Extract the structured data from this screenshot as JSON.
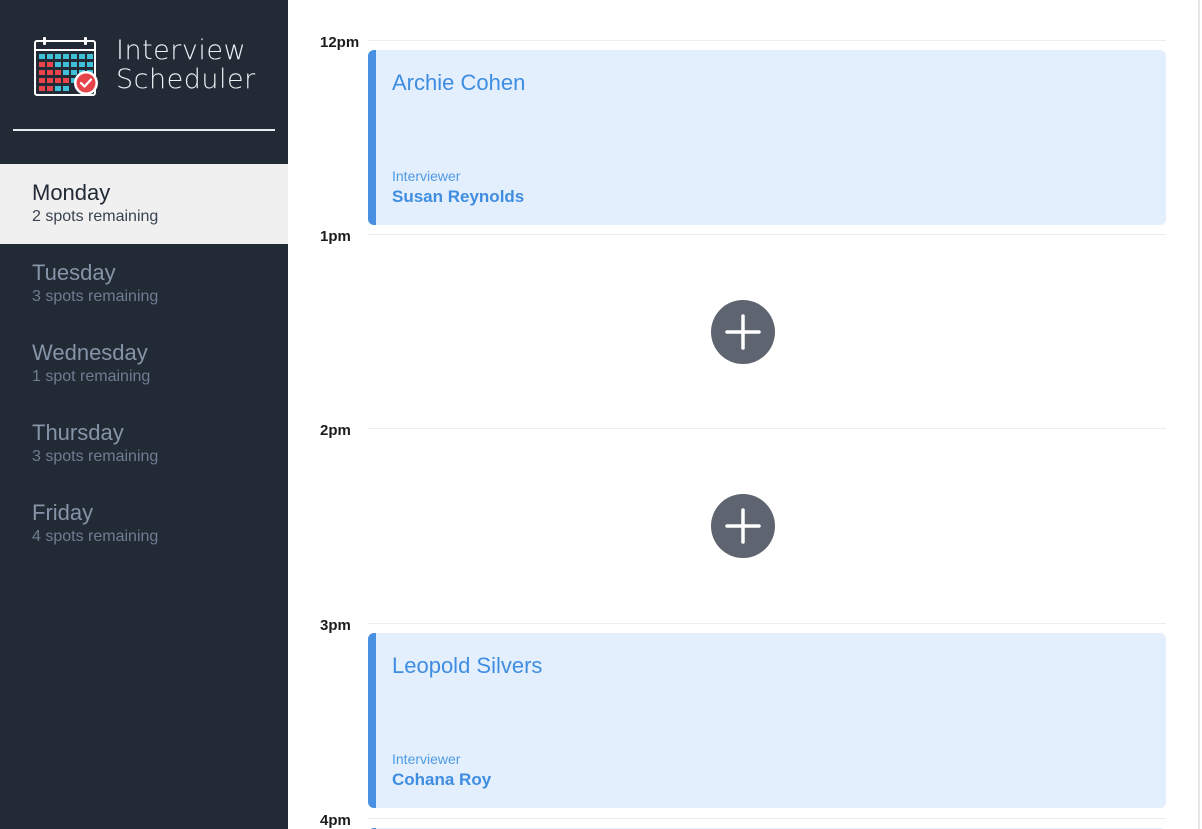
{
  "app": {
    "title_line1": "Interview",
    "title_line2": "Scheduler",
    "logo_icon": "calendar-check-icon"
  },
  "sidebar": {
    "days": [
      {
        "name": "Monday",
        "spots": "2 spots remaining",
        "selected": true
      },
      {
        "name": "Tuesday",
        "spots": "3 spots remaining",
        "selected": false
      },
      {
        "name": "Wednesday",
        "spots": "1 spot remaining",
        "selected": false
      },
      {
        "name": "Thursday",
        "spots": "3 spots remaining",
        "selected": false
      },
      {
        "name": "Friday",
        "spots": "4 spots remaining",
        "selected": false
      }
    ]
  },
  "schedule": {
    "slots": [
      {
        "time": "12pm",
        "booked": true,
        "student": "Archie Cohen",
        "interviewer_label": "Interviewer",
        "interviewer": "Susan Reynolds"
      },
      {
        "time": "1pm",
        "booked": false,
        "add_icon": "plus-icon"
      },
      {
        "time": "2pm",
        "booked": false,
        "add_icon": "plus-icon"
      },
      {
        "time": "3pm",
        "booked": true,
        "student": "Leopold Silvers",
        "interviewer_label": "Interviewer",
        "interviewer": "Cohana Roy"
      },
      {
        "time": "4pm",
        "booked": true
      }
    ]
  },
  "colors": {
    "sidebar_bg": "#222a36",
    "selected_bg": "#f0f0f0",
    "appointment_bg": "#e3effd",
    "appointment_accent": "#4a90e2",
    "add_button": "#5e6470"
  }
}
